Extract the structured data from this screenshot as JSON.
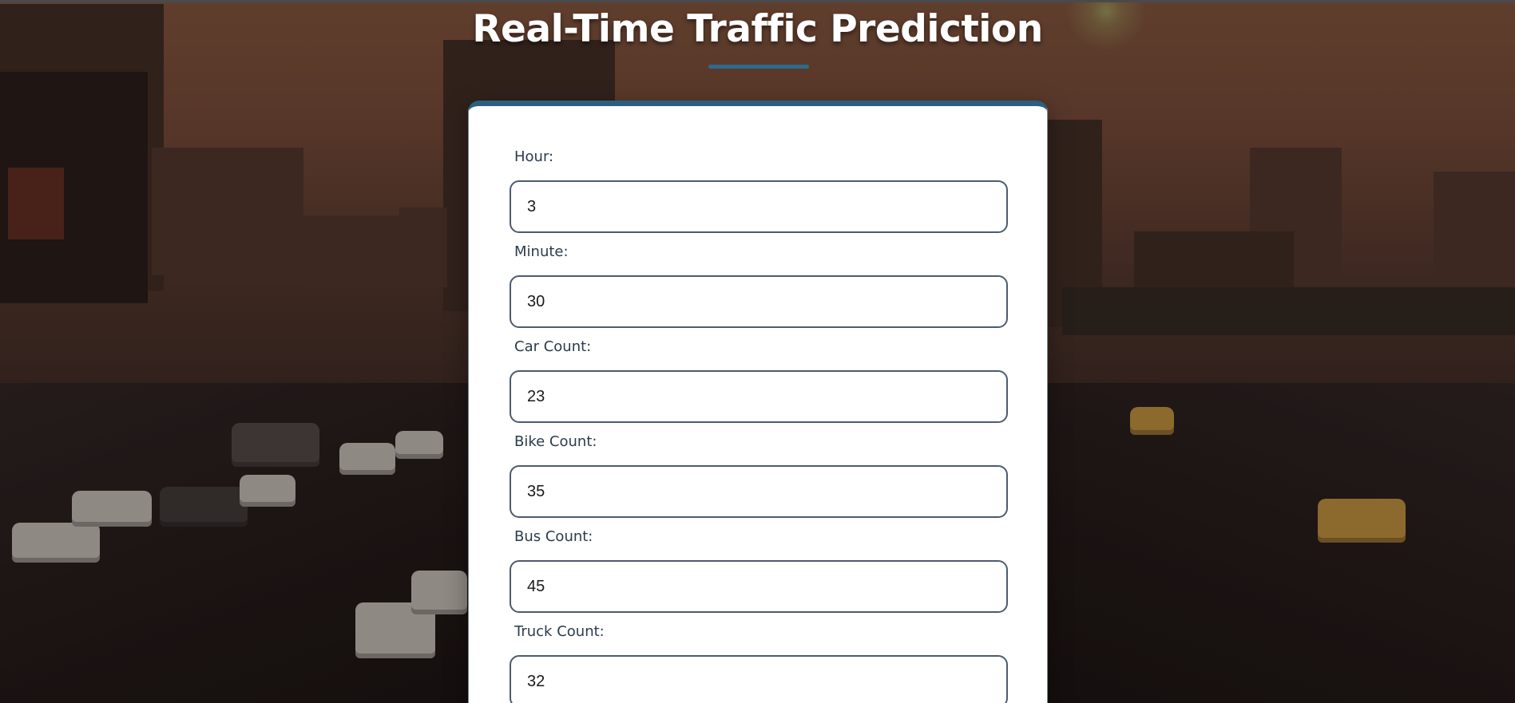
{
  "page": {
    "title": "Real-Time Traffic Prediction"
  },
  "form": {
    "fields": [
      {
        "label": "Hour:",
        "value": "3"
      },
      {
        "label": "Minute:",
        "value": "30"
      },
      {
        "label": "Car Count:",
        "value": "23"
      },
      {
        "label": "Bike Count:",
        "value": "35"
      },
      {
        "label": "Bus Count:",
        "value": "45"
      },
      {
        "label": "Truck Count:",
        "value": "32"
      }
    ]
  },
  "colors": {
    "accent": "#2a5f80",
    "input_border": "#4d5b6e",
    "label_text": "#2b3b4d"
  }
}
